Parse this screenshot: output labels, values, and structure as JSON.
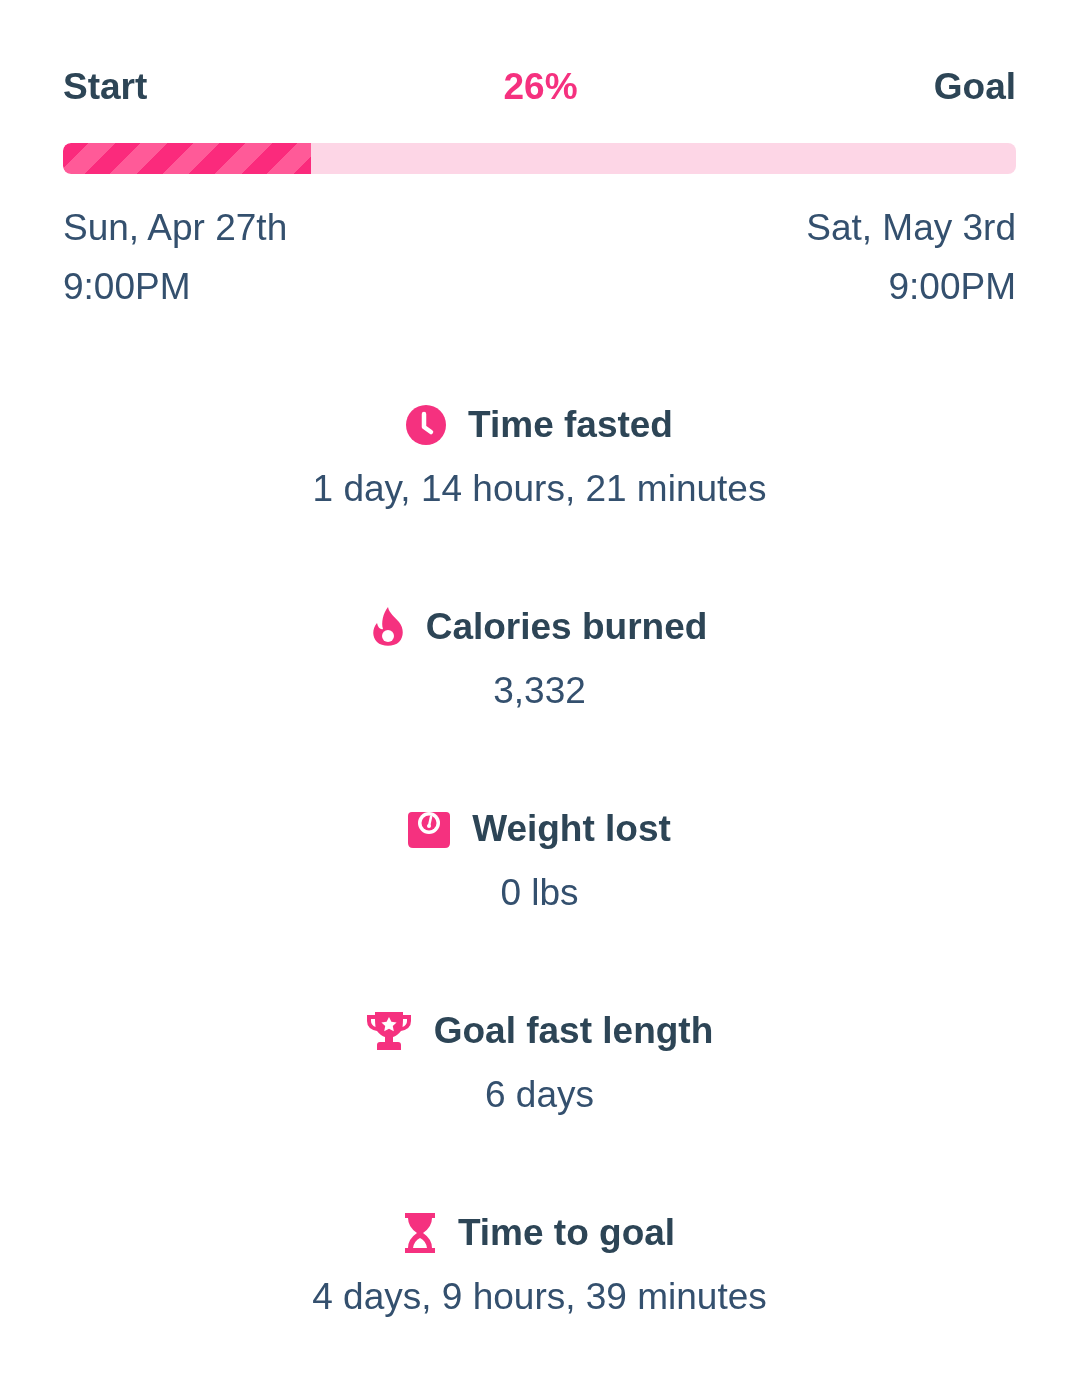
{
  "progress": {
    "start_label": "Start",
    "percent": "26%",
    "goal_label": "Goal",
    "level": 0.26,
    "start_date": "Sun, Apr 27th",
    "start_time": "9:00PM",
    "goal_date": "Sat, May 3rd",
    "goal_time": "9:00PM"
  },
  "stats": [
    {
      "kind": "clock",
      "title": "Time fasted",
      "value": "1 day, 14 hours, 21 minutes"
    },
    {
      "kind": "flame",
      "title": "Calories burned",
      "value": "3,332"
    },
    {
      "kind": "scale",
      "title": "Weight lost",
      "value": "0 lbs"
    },
    {
      "kind": "trophy",
      "title": "Goal fast length",
      "value": "6 days"
    },
    {
      "kind": "hourglass",
      "title": "Time to goal",
      "value": "4 days, 9 hours, 39 minutes"
    }
  ]
}
